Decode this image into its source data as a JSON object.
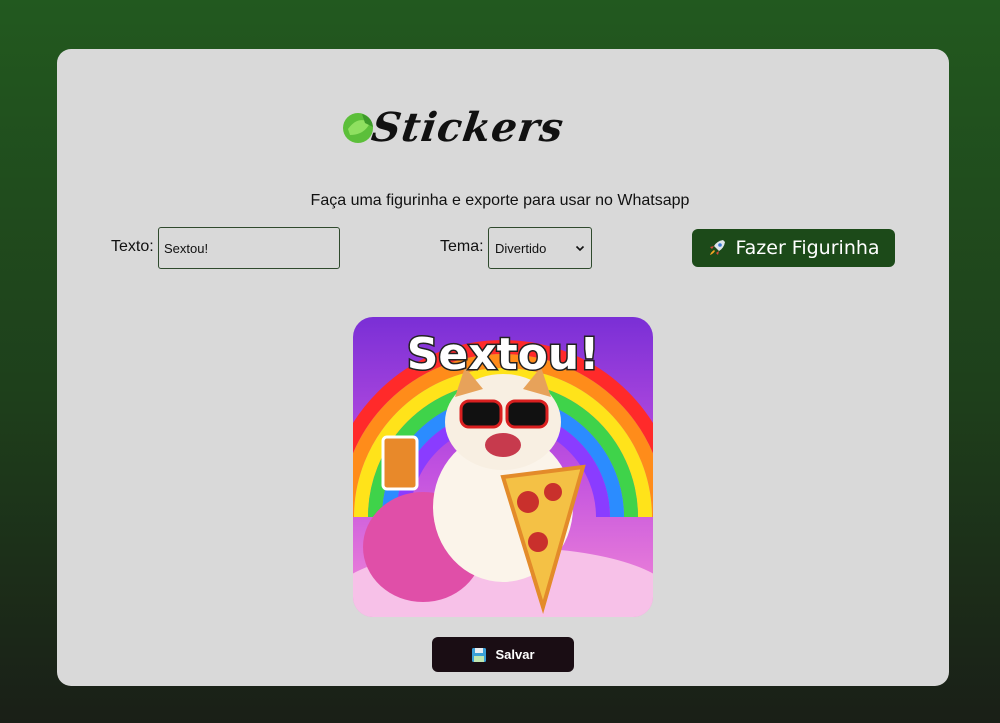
{
  "app": {
    "logo_text": "Stickers",
    "tagline": "Faça uma figurinha e exporte para usar no Whatsapp"
  },
  "form": {
    "text_label": "Texto:",
    "text_value": "Sextou!",
    "theme_label": "Tema:",
    "theme_selected": "Divertido",
    "make_button_label": "Fazer Figurinha",
    "make_button_icon": "rocket-icon"
  },
  "sticker": {
    "caption": "Sextou!"
  },
  "actions": {
    "save_label": "Salvar",
    "save_icon": "floppy-disk-icon"
  },
  "colors": {
    "primary_green": "#1c4a19",
    "card_bg": "#d9d9d9",
    "save_bg": "#1a0d14"
  }
}
